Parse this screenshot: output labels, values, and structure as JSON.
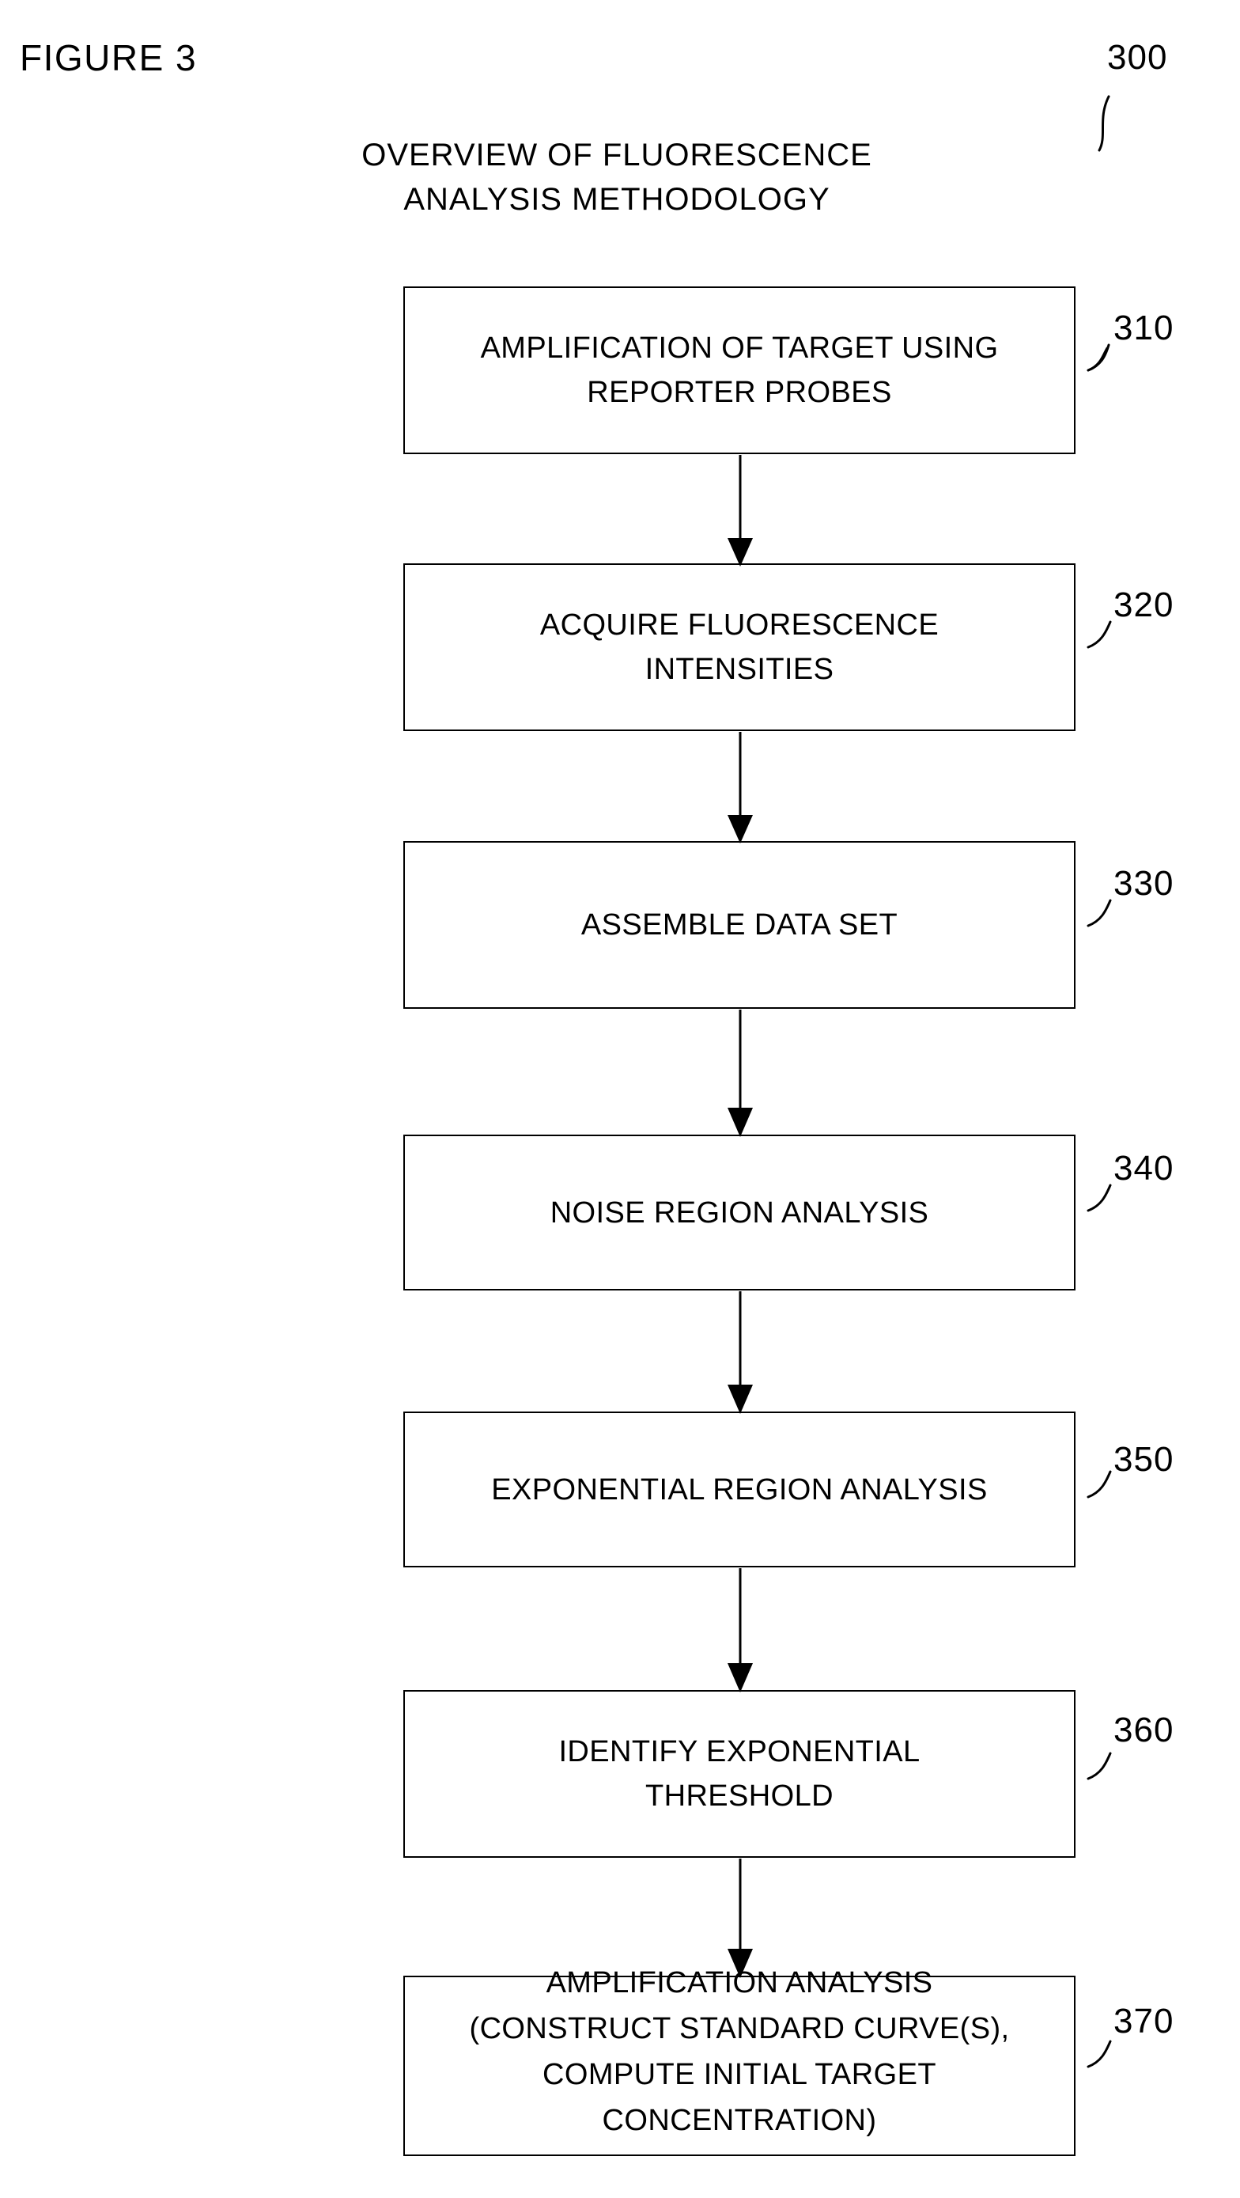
{
  "figure": {
    "label": "FIGURE 3",
    "ref": "300"
  },
  "title": {
    "line1": "OVERVIEW OF FLUORESCENCE",
    "line2": "ANALYSIS METHODOLOGY"
  },
  "flow": {
    "steps": [
      {
        "ref": "310",
        "lines": [
          "AMPLIFICATION OF TARGET USING",
          "REPORTER PROBES"
        ],
        "text": "AMPLIFICATION OF TARGET USING REPORTER PROBES"
      },
      {
        "ref": "320",
        "lines": [
          "ACQUIRE FLUORESCENCE",
          "INTENSITIES"
        ],
        "text": "ACQUIRE FLUORESCENCE INTENSITIES"
      },
      {
        "ref": "330",
        "lines": [
          "ASSEMBLE DATA SET"
        ],
        "text": "ASSEMBLE DATA SET"
      },
      {
        "ref": "340",
        "lines": [
          "NOISE REGION ANALYSIS"
        ],
        "text": "NOISE REGION ANALYSIS"
      },
      {
        "ref": "350",
        "lines": [
          "EXPONENTIAL REGION ANALYSIS"
        ],
        "text": "EXPONENTIAL REGION ANALYSIS"
      },
      {
        "ref": "360",
        "lines": [
          "IDENTIFY EXPONENTIAL",
          "THRESHOLD"
        ],
        "text": "IDENTIFY EXPONENTIAL THRESHOLD"
      },
      {
        "ref": "370",
        "lines": [
          "AMPLIFICATION ANALYSIS",
          "(CONSTRUCT STANDARD CURVE(S),",
          "COMPUTE INITIAL TARGET",
          "CONCENTRATION)"
        ],
        "text": "AMPLIFICATION ANALYSIS (CONSTRUCT STANDARD CURVE(S), COMPUTE INITIAL TARGET CONCENTRATION)"
      }
    ]
  },
  "style": {
    "ink": "#000000",
    "paper": "#ffffff"
  }
}
